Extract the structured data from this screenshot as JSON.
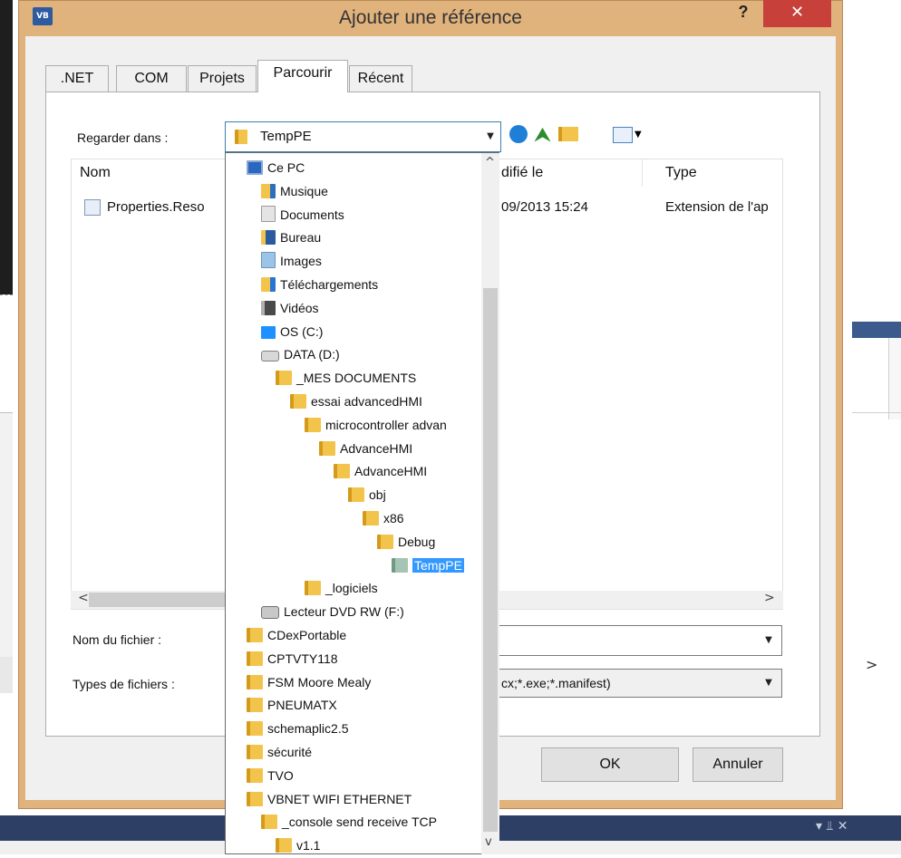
{
  "dialog": {
    "title": "Ajouter une référence",
    "app_icon": "VB",
    "help_label": "?",
    "close_label": "✕"
  },
  "tabs": [
    {
      "label": ".NET"
    },
    {
      "label": "COM"
    },
    {
      "label": "Projets"
    },
    {
      "label": "Parcourir",
      "active": true
    },
    {
      "label": "Récent"
    }
  ],
  "look_in": {
    "label": "Regarder dans :",
    "value": "TempPE"
  },
  "toolbar": {
    "back_icon": "back-icon",
    "up_icon": "up-folder-icon",
    "new_folder_icon": "new-folder-icon",
    "view_icon": "view-menu-icon"
  },
  "list": {
    "columns": [
      {
        "label": "Nom"
      },
      {
        "label": "Modifié le",
        "visible_text": "difié le"
      },
      {
        "label": "Type"
      }
    ],
    "rows": [
      {
        "name": "Properties.Reso",
        "modified": "09/2013 15:24",
        "type": "Extension de l'ap"
      }
    ]
  },
  "dropdown_tree": [
    {
      "label": "Ce PC",
      "icon": "pc-icon",
      "level": 0
    },
    {
      "label": "Musique",
      "icon": "music-folder-icon",
      "level": 1
    },
    {
      "label": "Documents",
      "icon": "documents-folder-icon",
      "level": 1
    },
    {
      "label": "Bureau",
      "icon": "desktop-folder-icon",
      "level": 1
    },
    {
      "label": "Images",
      "icon": "images-folder-icon",
      "level": 1
    },
    {
      "label": "Téléchargements",
      "icon": "downloads-folder-icon",
      "level": 1
    },
    {
      "label": "Vidéos",
      "icon": "videos-folder-icon",
      "level": 1
    },
    {
      "label": "OS (C:)",
      "icon": "windows-drive-icon",
      "level": 1
    },
    {
      "label": "DATA (D:)",
      "icon": "drive-icon",
      "level": 1
    },
    {
      "label": "_MES DOCUMENTS",
      "icon": "folder-icon",
      "level": 2
    },
    {
      "label": "essai advancedHMI",
      "icon": "folder-icon",
      "level": 3
    },
    {
      "label": "microcontroller advan",
      "icon": "folder-icon",
      "level": 4
    },
    {
      "label": "AdvanceHMI",
      "icon": "folder-icon",
      "level": 5
    },
    {
      "label": "AdvanceHMI",
      "icon": "folder-icon",
      "level": 6
    },
    {
      "label": "obj",
      "icon": "folder-icon",
      "level": 7
    },
    {
      "label": "x86",
      "icon": "folder-icon",
      "level": 8
    },
    {
      "label": "Debug",
      "icon": "folder-icon",
      "level": 9
    },
    {
      "label": "TempPE",
      "icon": "open-folder-icon",
      "level": 10,
      "selected": true
    },
    {
      "label": "_logiciels",
      "icon": "folder-icon",
      "level": 4
    },
    {
      "label": "Lecteur DVD RW (F:)",
      "icon": "dvd-drive-icon",
      "level": 1
    },
    {
      "label": "CDexPortable",
      "icon": "folder-icon",
      "level": 0
    },
    {
      "label": "CPTVTY118",
      "icon": "folder-icon",
      "level": 0
    },
    {
      "label": "FSM Moore Mealy",
      "icon": "folder-icon",
      "level": 0
    },
    {
      "label": "PNEUMATX",
      "icon": "folder-icon",
      "level": 0
    },
    {
      "label": "schemaplic2.5",
      "icon": "folder-icon",
      "level": 0
    },
    {
      "label": "sécurité",
      "icon": "folder-icon",
      "level": 0
    },
    {
      "label": "TVO",
      "icon": "folder-icon",
      "level": 0
    },
    {
      "label": "VBNET WIFI ETHERNET",
      "icon": "folder-icon",
      "level": 0
    },
    {
      "label": "_console send receive TCP",
      "icon": "folder-icon",
      "level": 1
    },
    {
      "label": "v1.1",
      "icon": "folder-icon",
      "level": 2
    }
  ],
  "filename": {
    "label": "Nom du fichier :",
    "value": ""
  },
  "filetype": {
    "label": "Types de fichiers :",
    "value": "cx;*.exe;*.manifest)"
  },
  "buttons": {
    "ok": "OK",
    "cancel": "Annuler"
  },
  "scroll": {
    "left_arrow": "<",
    "right_arrow": ">",
    "up_arrow": "^",
    "down_arrow": "v"
  },
  "background": {
    "right_arrow": ">",
    "bottom_icons": "▾ ⫫ ✕"
  }
}
